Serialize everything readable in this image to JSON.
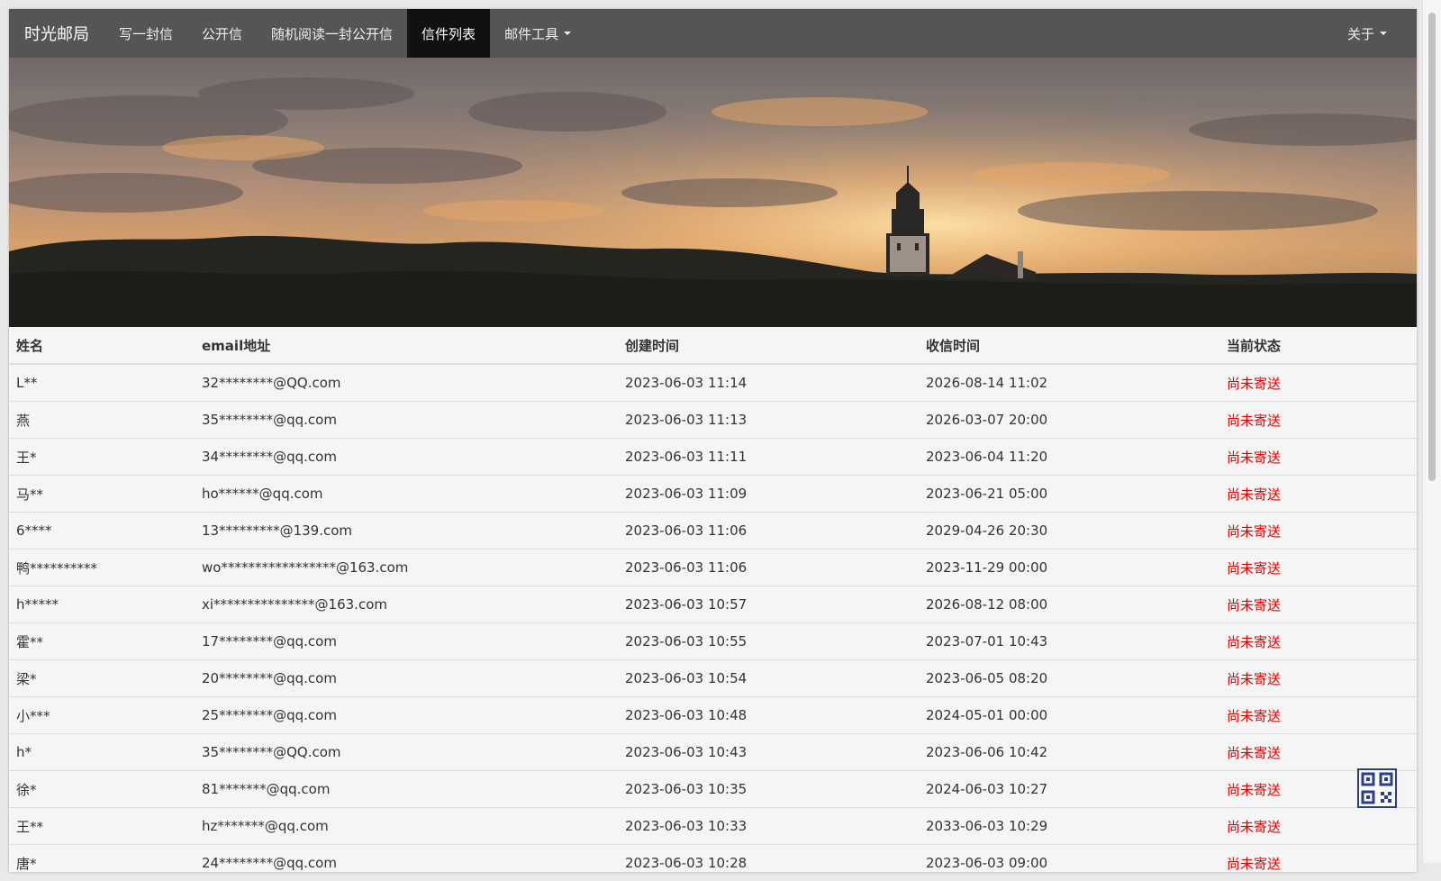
{
  "navbar": {
    "brand": "时光邮局",
    "items": [
      {
        "label": "写一封信",
        "active": false
      },
      {
        "label": "公开信",
        "active": false
      },
      {
        "label": "随机阅读一封公开信",
        "active": false
      },
      {
        "label": "信件列表",
        "active": true
      },
      {
        "label": "邮件工具",
        "active": false
      }
    ],
    "about_label": "关于"
  },
  "table": {
    "headers": [
      "姓名",
      "email地址",
      "创建时间",
      "收信时间",
      "当前状态"
    ],
    "rows": [
      [
        "L**",
        "32********@QQ.com",
        "2023-06-03 11:14",
        "2026-08-14 11:02",
        "尚未寄送"
      ],
      [
        "燕",
        "35********@qq.com",
        "2023-06-03 11:13",
        "2026-03-07 20:00",
        "尚未寄送"
      ],
      [
        "王*",
        "34********@qq.com",
        "2023-06-03 11:11",
        "2023-06-04 11:20",
        "尚未寄送"
      ],
      [
        "马**",
        "ho******@qq.com",
        "2023-06-03 11:09",
        "2023-06-21 05:00",
        "尚未寄送"
      ],
      [
        "6****",
        "13*********@139.com",
        "2023-06-03 11:06",
        "2029-04-26 20:30",
        "尚未寄送"
      ],
      [
        "鸭**********",
        "wo*****************@163.com",
        "2023-06-03 11:06",
        "2023-11-29 00:00",
        "尚未寄送"
      ],
      [
        "h*****",
        "xi***************@163.com",
        "2023-06-03 10:57",
        "2026-08-12 08:00",
        "尚未寄送"
      ],
      [
        "霍**",
        "17********@qq.com",
        "2023-06-03 10:55",
        "2023-07-01 10:43",
        "尚未寄送"
      ],
      [
        "梁*",
        "20********@qq.com",
        "2023-06-03 10:54",
        "2023-06-05 08:20",
        "尚未寄送"
      ],
      [
        "小***",
        "25********@qq.com",
        "2023-06-03 10:48",
        "2024-05-01 00:00",
        "尚未寄送"
      ],
      [
        "h*",
        "35********@QQ.com",
        "2023-06-03 10:43",
        "2023-06-06 10:42",
        "尚未寄送"
      ],
      [
        "徐*",
        "81*******@qq.com",
        "2023-06-03 10:35",
        "2024-06-03 10:27",
        "尚未寄送"
      ],
      [
        "王**",
        "hz*******@qq.com",
        "2023-06-03 10:33",
        "2033-06-03 10:29",
        "尚未寄送"
      ],
      [
        "唐*",
        "24********@qq.com",
        "2023-06-03 10:28",
        "2023-06-03 09:00",
        "尚未寄送"
      ]
    ]
  },
  "icons": {
    "caret": "caret-down-icon",
    "qr": "qr-code-icon"
  },
  "colors": {
    "navbar_bg": "#555555",
    "nav_active_bg": "#111111",
    "status_text": "#e60000",
    "qr_border": "#2b3e8e"
  }
}
